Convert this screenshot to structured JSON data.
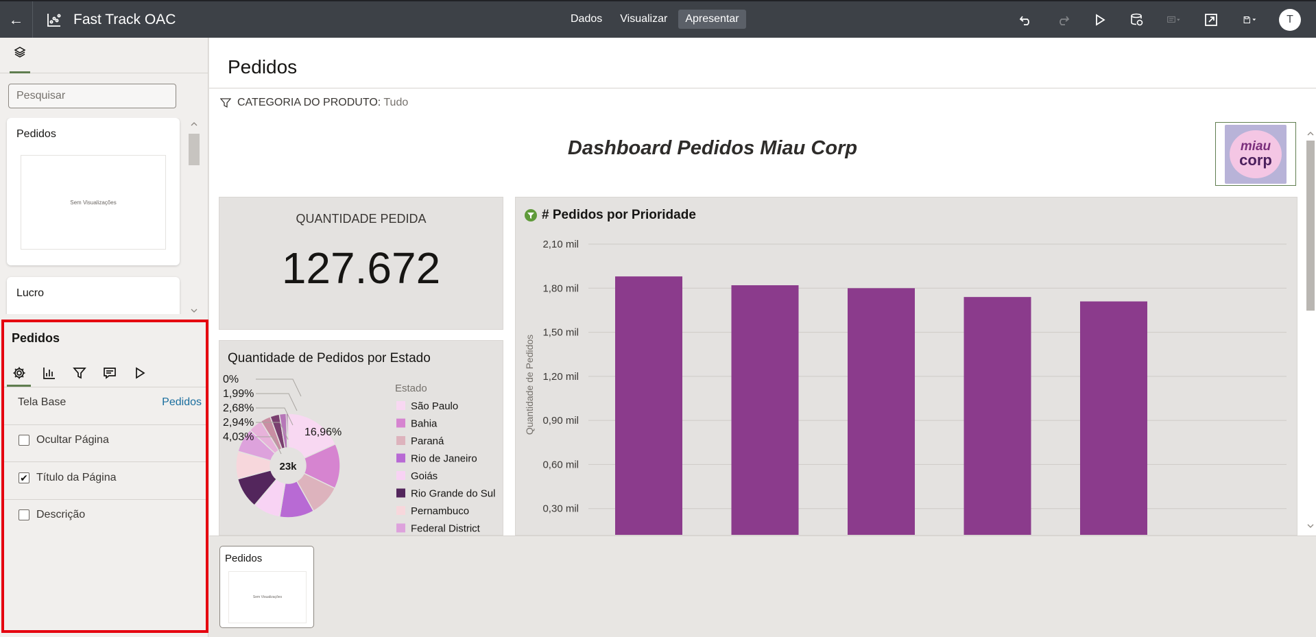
{
  "app": {
    "title": "Fast Track OAC",
    "modes": [
      {
        "label": "Dados",
        "active": false
      },
      {
        "label": "Visualizar",
        "active": false
      },
      {
        "label": "Apresentar",
        "active": true
      }
    ],
    "tools": [
      "undo-icon",
      "redo-icon",
      "play-icon",
      "refresh-data-icon",
      "narrate-icon",
      "export-icon",
      "save-icon"
    ],
    "user_initial": "T"
  },
  "sidebar": {
    "search_placeholder": "Pesquisar",
    "pages": [
      {
        "title": "Pedidos",
        "thumb_text": "Sem Visualizações"
      },
      {
        "title": "Lucro"
      }
    ]
  },
  "properties": {
    "title": "Pedidos",
    "tabs": [
      "gear-icon",
      "chart-icon",
      "filter-icon",
      "comment-icon",
      "play-icon"
    ],
    "base_canvas_label": "Tela Base",
    "base_canvas_value": "Pedidos",
    "options": [
      {
        "label": "Ocultar Página",
        "checked": false
      },
      {
        "label": "Título da Página",
        "checked": true
      },
      {
        "label": "Descrição",
        "checked": false
      }
    ]
  },
  "canvas": {
    "page_title": "Pedidos",
    "filter_label": "CATEGORIA DO PRODUTO:",
    "filter_value": "Tudo",
    "dashboard_title": "Dashboard Pedidos Miau Corp",
    "logo_text_1": "miau",
    "logo_text_2": "corp",
    "kpi": {
      "label": "QUANTIDADE PEDIDA",
      "value": "127.672"
    }
  },
  "chart_data": [
    {
      "type": "pie",
      "title": "Quantidade de Pedidos por Estado",
      "legend_title": "Estado",
      "center_label": "23k",
      "categories": [
        "São Paulo",
        "Bahia",
        "Paraná",
        "Rio de Janeiro",
        "Goiás",
        "Rio Grande do Sul",
        "Pernambuco",
        "Federal District"
      ],
      "colors": [
        "#f8d8f2",
        "#d684d0",
        "#ddb3bd",
        "#b86ad4",
        "#f8d3f4",
        "#53265c",
        "#f7d7dc",
        "#dda2dc"
      ],
      "visible_slice_labels": [
        "16,96%",
        "4,03%",
        "2,94%",
        "2,68%",
        "1,99%",
        "0%"
      ],
      "slices": [
        {
          "label": "São Paulo",
          "value": 16.96
        },
        {
          "label": "Bahia",
          "value": 13.0
        },
        {
          "label": "Paraná",
          "value": 9.0
        },
        {
          "label": "Rio de Janeiro",
          "value": 10.0
        },
        {
          "label": "Goiás",
          "value": 8.0
        },
        {
          "label": "Rio Grande do Sul",
          "value": 9.0
        },
        {
          "label": "Pernambuco",
          "value": 8.0
        },
        {
          "label": "Federal District",
          "value": 7.0
        },
        {
          "label": "",
          "value": 4.03
        },
        {
          "label": "",
          "value": 2.94
        },
        {
          "label": "",
          "value": 2.68
        },
        {
          "label": "",
          "value": 1.99
        },
        {
          "label": "",
          "value": 0.5
        }
      ]
    },
    {
      "type": "bar",
      "title": "# Pedidos por Prioridade",
      "ylabel": "Quantidade de Pedidos",
      "yticks": [
        "0,30 mil",
        "0,60 mil",
        "0,90 mil",
        "1,20 mil",
        "1,50 mil",
        "1,80 mil",
        "2,10 mil"
      ],
      "ylim": [
        0,
        2100
      ],
      "values": [
        1880,
        1820,
        1800,
        1740,
        1710
      ],
      "bar_color": "#8b3b8c"
    }
  ],
  "strip": {
    "page_title": "Pedidos",
    "thumb_text": "Sem Visualizações"
  }
}
